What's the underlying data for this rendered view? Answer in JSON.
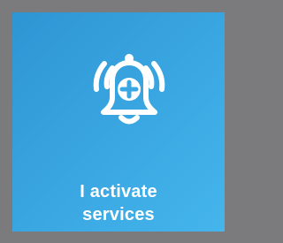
{
  "tile": {
    "icon": "bell-plus-alert-icon",
    "label_line1": "I activate",
    "label_line2": "services",
    "colors": {
      "background": "#7b7b7d",
      "tile_start": "#2e95d3",
      "tile_end": "#45b5ec",
      "foreground": "#ffffff"
    }
  }
}
